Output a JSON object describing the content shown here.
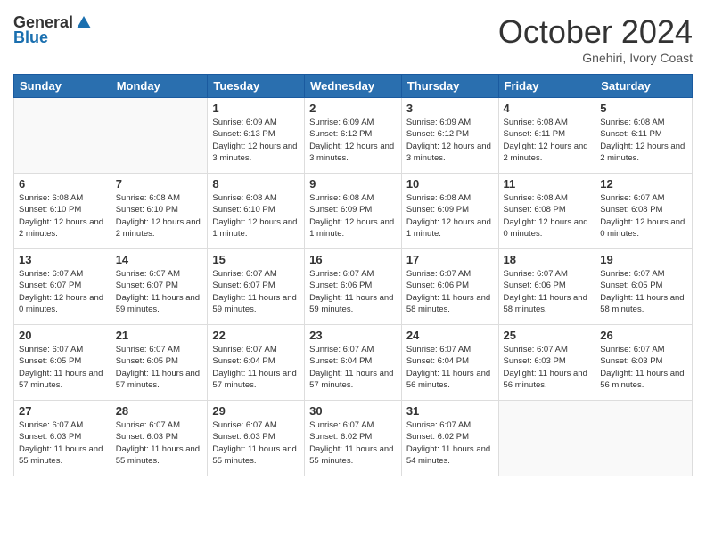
{
  "header": {
    "logo_general": "General",
    "logo_blue": "Blue",
    "month_title": "October 2024",
    "location": "Gnehiri, Ivory Coast"
  },
  "days_of_week": [
    "Sunday",
    "Monday",
    "Tuesday",
    "Wednesday",
    "Thursday",
    "Friday",
    "Saturday"
  ],
  "weeks": [
    [
      {
        "day": "",
        "info": ""
      },
      {
        "day": "",
        "info": ""
      },
      {
        "day": "1",
        "info": "Sunrise: 6:09 AM\nSunset: 6:13 PM\nDaylight: 12 hours and 3 minutes."
      },
      {
        "day": "2",
        "info": "Sunrise: 6:09 AM\nSunset: 6:12 PM\nDaylight: 12 hours and 3 minutes."
      },
      {
        "day": "3",
        "info": "Sunrise: 6:09 AM\nSunset: 6:12 PM\nDaylight: 12 hours and 3 minutes."
      },
      {
        "day": "4",
        "info": "Sunrise: 6:08 AM\nSunset: 6:11 PM\nDaylight: 12 hours and 2 minutes."
      },
      {
        "day": "5",
        "info": "Sunrise: 6:08 AM\nSunset: 6:11 PM\nDaylight: 12 hours and 2 minutes."
      }
    ],
    [
      {
        "day": "6",
        "info": "Sunrise: 6:08 AM\nSunset: 6:10 PM\nDaylight: 12 hours and 2 minutes."
      },
      {
        "day": "7",
        "info": "Sunrise: 6:08 AM\nSunset: 6:10 PM\nDaylight: 12 hours and 2 minutes."
      },
      {
        "day": "8",
        "info": "Sunrise: 6:08 AM\nSunset: 6:10 PM\nDaylight: 12 hours and 1 minute."
      },
      {
        "day": "9",
        "info": "Sunrise: 6:08 AM\nSunset: 6:09 PM\nDaylight: 12 hours and 1 minute."
      },
      {
        "day": "10",
        "info": "Sunrise: 6:08 AM\nSunset: 6:09 PM\nDaylight: 12 hours and 1 minute."
      },
      {
        "day": "11",
        "info": "Sunrise: 6:08 AM\nSunset: 6:08 PM\nDaylight: 12 hours and 0 minutes."
      },
      {
        "day": "12",
        "info": "Sunrise: 6:07 AM\nSunset: 6:08 PM\nDaylight: 12 hours and 0 minutes."
      }
    ],
    [
      {
        "day": "13",
        "info": "Sunrise: 6:07 AM\nSunset: 6:07 PM\nDaylight: 12 hours and 0 minutes."
      },
      {
        "day": "14",
        "info": "Sunrise: 6:07 AM\nSunset: 6:07 PM\nDaylight: 11 hours and 59 minutes."
      },
      {
        "day": "15",
        "info": "Sunrise: 6:07 AM\nSunset: 6:07 PM\nDaylight: 11 hours and 59 minutes."
      },
      {
        "day": "16",
        "info": "Sunrise: 6:07 AM\nSunset: 6:06 PM\nDaylight: 11 hours and 59 minutes."
      },
      {
        "day": "17",
        "info": "Sunrise: 6:07 AM\nSunset: 6:06 PM\nDaylight: 11 hours and 58 minutes."
      },
      {
        "day": "18",
        "info": "Sunrise: 6:07 AM\nSunset: 6:06 PM\nDaylight: 11 hours and 58 minutes."
      },
      {
        "day": "19",
        "info": "Sunrise: 6:07 AM\nSunset: 6:05 PM\nDaylight: 11 hours and 58 minutes."
      }
    ],
    [
      {
        "day": "20",
        "info": "Sunrise: 6:07 AM\nSunset: 6:05 PM\nDaylight: 11 hours and 57 minutes."
      },
      {
        "day": "21",
        "info": "Sunrise: 6:07 AM\nSunset: 6:05 PM\nDaylight: 11 hours and 57 minutes."
      },
      {
        "day": "22",
        "info": "Sunrise: 6:07 AM\nSunset: 6:04 PM\nDaylight: 11 hours and 57 minutes."
      },
      {
        "day": "23",
        "info": "Sunrise: 6:07 AM\nSunset: 6:04 PM\nDaylight: 11 hours and 57 minutes."
      },
      {
        "day": "24",
        "info": "Sunrise: 6:07 AM\nSunset: 6:04 PM\nDaylight: 11 hours and 56 minutes."
      },
      {
        "day": "25",
        "info": "Sunrise: 6:07 AM\nSunset: 6:03 PM\nDaylight: 11 hours and 56 minutes."
      },
      {
        "day": "26",
        "info": "Sunrise: 6:07 AM\nSunset: 6:03 PM\nDaylight: 11 hours and 56 minutes."
      }
    ],
    [
      {
        "day": "27",
        "info": "Sunrise: 6:07 AM\nSunset: 6:03 PM\nDaylight: 11 hours and 55 minutes."
      },
      {
        "day": "28",
        "info": "Sunrise: 6:07 AM\nSunset: 6:03 PM\nDaylight: 11 hours and 55 minutes."
      },
      {
        "day": "29",
        "info": "Sunrise: 6:07 AM\nSunset: 6:03 PM\nDaylight: 11 hours and 55 minutes."
      },
      {
        "day": "30",
        "info": "Sunrise: 6:07 AM\nSunset: 6:02 PM\nDaylight: 11 hours and 55 minutes."
      },
      {
        "day": "31",
        "info": "Sunrise: 6:07 AM\nSunset: 6:02 PM\nDaylight: 11 hours and 54 minutes."
      },
      {
        "day": "",
        "info": ""
      },
      {
        "day": "",
        "info": ""
      }
    ]
  ]
}
